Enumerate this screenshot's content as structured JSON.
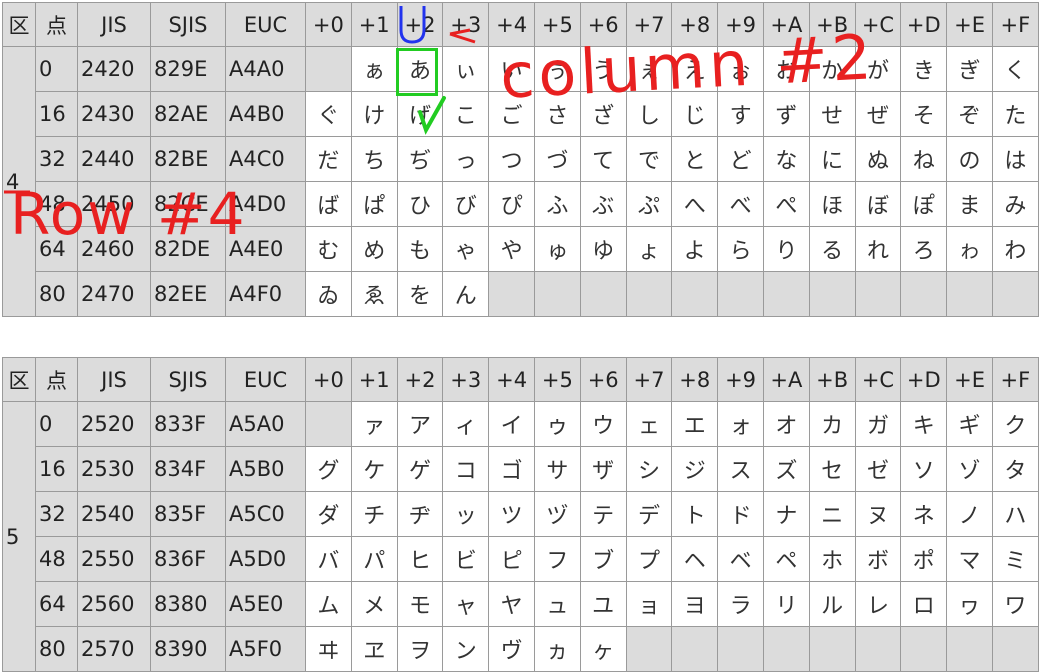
{
  "headers": [
    "区",
    "点",
    "JIS",
    "SJIS",
    "EUC",
    "+0",
    "+1",
    "+2",
    "+3",
    "+4",
    "+5",
    "+6",
    "+7",
    "+8",
    "+9",
    "+A",
    "+B",
    "+C",
    "+D",
    "+E",
    "+F"
  ],
  "tables": [
    {
      "ku": "4",
      "rows": [
        {
          "ten": "0",
          "jis": "2420",
          "sjis": "829E",
          "euc": "A4A0",
          "chars": [
            "",
            "ぁ",
            "あ",
            "ぃ",
            "い",
            "ぅ",
            "う",
            "ぇ",
            "え",
            "ぉ",
            "お",
            "か",
            "が",
            "き",
            "ぎ",
            "く"
          ]
        },
        {
          "ten": "16",
          "jis": "2430",
          "sjis": "82AE",
          "euc": "A4B0",
          "chars": [
            "ぐ",
            "け",
            "げ",
            "こ",
            "ご",
            "さ",
            "ざ",
            "し",
            "じ",
            "す",
            "ず",
            "せ",
            "ぜ",
            "そ",
            "ぞ",
            "た"
          ]
        },
        {
          "ten": "32",
          "jis": "2440",
          "sjis": "82BE",
          "euc": "A4C0",
          "chars": [
            "だ",
            "ち",
            "ぢ",
            "っ",
            "つ",
            "づ",
            "て",
            "で",
            "と",
            "ど",
            "な",
            "に",
            "ぬ",
            "ね",
            "の",
            "は"
          ]
        },
        {
          "ten": "48",
          "jis": "2450",
          "sjis": "82CE",
          "euc": "A4D0",
          "chars": [
            "ば",
            "ぱ",
            "ひ",
            "び",
            "ぴ",
            "ふ",
            "ぶ",
            "ぷ",
            "へ",
            "べ",
            "ぺ",
            "ほ",
            "ぼ",
            "ぽ",
            "ま",
            "み"
          ]
        },
        {
          "ten": "64",
          "jis": "2460",
          "sjis": "82DE",
          "euc": "A4E0",
          "chars": [
            "む",
            "め",
            "も",
            "ゃ",
            "や",
            "ゅ",
            "ゆ",
            "ょ",
            "よ",
            "ら",
            "り",
            "る",
            "れ",
            "ろ",
            "ゎ",
            "わ"
          ]
        },
        {
          "ten": "80",
          "jis": "2470",
          "sjis": "82EE",
          "euc": "A4F0",
          "chars": [
            "ゐ",
            "ゑ",
            "を",
            "ん",
            "",
            "",
            "",
            "",
            "",
            "",
            "",
            "",
            "",
            "",
            "",
            ""
          ]
        }
      ]
    },
    {
      "ku": "5",
      "rows": [
        {
          "ten": "0",
          "jis": "2520",
          "sjis": "833F",
          "euc": "A5A0",
          "chars": [
            "",
            "ァ",
            "ア",
            "ィ",
            "イ",
            "ゥ",
            "ウ",
            "ェ",
            "エ",
            "ォ",
            "オ",
            "カ",
            "ガ",
            "キ",
            "ギ",
            "ク"
          ]
        },
        {
          "ten": "16",
          "jis": "2530",
          "sjis": "834F",
          "euc": "A5B0",
          "chars": [
            "グ",
            "ケ",
            "ゲ",
            "コ",
            "ゴ",
            "サ",
            "ザ",
            "シ",
            "ジ",
            "ス",
            "ズ",
            "セ",
            "ゼ",
            "ソ",
            "ゾ",
            "タ"
          ]
        },
        {
          "ten": "32",
          "jis": "2540",
          "sjis": "835F",
          "euc": "A5C0",
          "chars": [
            "ダ",
            "チ",
            "ヂ",
            "ッ",
            "ツ",
            "ヅ",
            "テ",
            "デ",
            "ト",
            "ド",
            "ナ",
            "ニ",
            "ヌ",
            "ネ",
            "ノ",
            "ハ"
          ]
        },
        {
          "ten": "48",
          "jis": "2550",
          "sjis": "836F",
          "euc": "A5D0",
          "chars": [
            "バ",
            "パ",
            "ヒ",
            "ビ",
            "ピ",
            "フ",
            "ブ",
            "プ",
            "ヘ",
            "ベ",
            "ペ",
            "ホ",
            "ボ",
            "ポ",
            "マ",
            "ミ"
          ]
        },
        {
          "ten": "64",
          "jis": "2560",
          "sjis": "8380",
          "euc": "A5E0",
          "chars": [
            "ム",
            "メ",
            "モ",
            "ャ",
            "ヤ",
            "ュ",
            "ユ",
            "ョ",
            "ヨ",
            "ラ",
            "リ",
            "ル",
            "レ",
            "ロ",
            "ヮ",
            "ワ"
          ]
        },
        {
          "ten": "80",
          "jis": "2570",
          "sjis": "8390",
          "euc": "A5F0",
          "chars": [
            "ヰ",
            "ヱ",
            "ヲ",
            "ン",
            "ヴ",
            "ヵ",
            "ヶ",
            "",
            "",
            "",
            "",
            "",
            "",
            "",
            "",
            ""
          ]
        }
      ]
    }
  ],
  "annotations": {
    "column_text": "column #2",
    "row_text": "Row #4",
    "u_mark": "U",
    "pen_color": "#e82020",
    "highlight_color": "#22cc22"
  }
}
